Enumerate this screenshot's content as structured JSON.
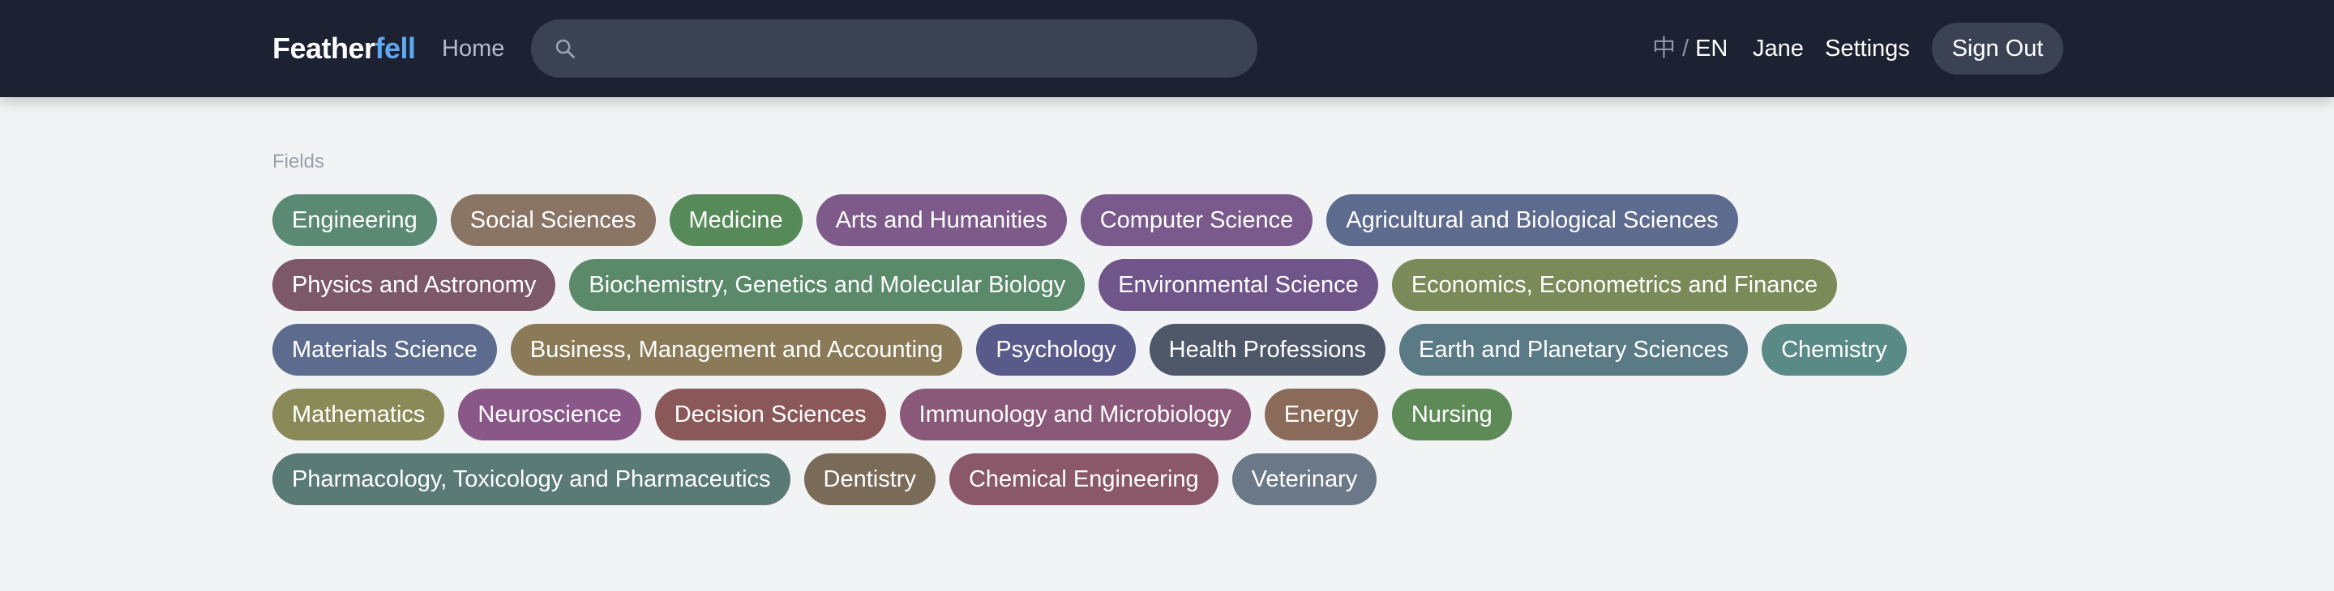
{
  "header": {
    "brand_part1": "Feather",
    "brand_part2": "fell",
    "home_label": "Home",
    "search_placeholder": "",
    "lang_zh": "中",
    "lang_sep": "/",
    "lang_en": "EN",
    "user_label": "Jane",
    "settings_label": "Settings",
    "signout_label": "Sign Out"
  },
  "fields_section": {
    "label": "Fields",
    "rows": [
      [
        {
          "label": "Engineering",
          "color": "#5a8a74"
        },
        {
          "label": "Social Sciences",
          "color": "#8a7564"
        },
        {
          "label": "Medicine",
          "color": "#568a58"
        },
        {
          "label": "Arts and Humanities",
          "color": "#7d5a8a"
        },
        {
          "label": "Computer Science",
          "color": "#7a5a8c"
        },
        {
          "label": "Agricultural and Biological Sciences",
          "color": "#5c6b8e"
        }
      ],
      [
        {
          "label": "Physics and Astronomy",
          "color": "#7d5868"
        },
        {
          "label": "Biochemistry, Genetics and Molecular Biology",
          "color": "#5a8a6a"
        },
        {
          "label": "Environmental Science",
          "color": "#6f558a"
        },
        {
          "label": "Economics, Econometrics and Finance",
          "color": "#7a8a58"
        }
      ],
      [
        {
          "label": "Materials Science",
          "color": "#5c6b8e"
        },
        {
          "label": "Business, Management and Accounting",
          "color": "#8a7a58"
        },
        {
          "label": "Psychology",
          "color": "#585a8a"
        },
        {
          "label": "Health Professions",
          "color": "#4e5868"
        },
        {
          "label": "Earth and Planetary Sciences",
          "color": "#5a7a86"
        },
        {
          "label": "Chemistry",
          "color": "#5a8a86"
        }
      ],
      [
        {
          "label": "Mathematics",
          "color": "#8a8a58"
        },
        {
          "label": "Neuroscience",
          "color": "#8a5888"
        },
        {
          "label": "Decision Sciences",
          "color": "#8a5858"
        },
        {
          "label": "Immunology and Microbiology",
          "color": "#8a5878"
        },
        {
          "label": "Energy",
          "color": "#8a6a58"
        },
        {
          "label": "Nursing",
          "color": "#5e8a58"
        }
      ],
      [
        {
          "label": "Pharmacology, Toxicology and Pharmaceutics",
          "color": "#5a7a76"
        },
        {
          "label": "Dentistry",
          "color": "#7a6a58"
        },
        {
          "label": "Chemical Engineering",
          "color": "#8a5868"
        },
        {
          "label": "Veterinary",
          "color": "#6a7888"
        }
      ]
    ]
  }
}
